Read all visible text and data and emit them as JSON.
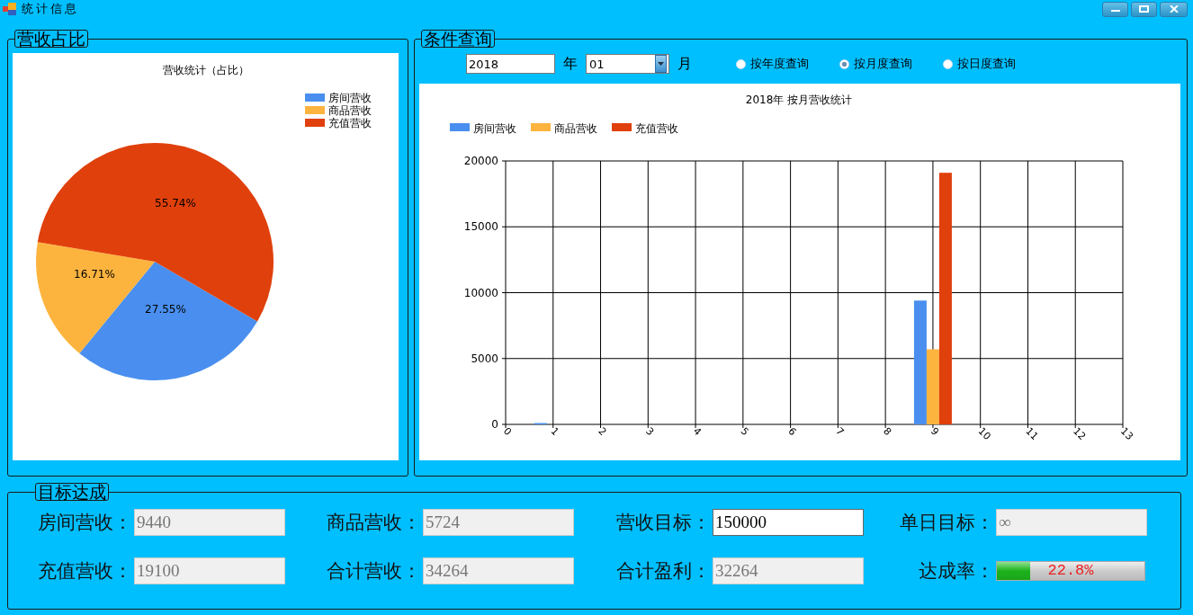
{
  "window": {
    "title": "统计信息"
  },
  "share_panel": {
    "title": "营收占比",
    "chart_data": {
      "type": "pie",
      "title": "营收统计（占比）",
      "categories": [
        "房间营收",
        "商品营收",
        "充值营收"
      ],
      "values": [
        27.55,
        16.71,
        55.74
      ],
      "colors": [
        "#4a8fef",
        "#fdb43f",
        "#e0400c"
      ],
      "value_labels": [
        "27.55%",
        "16.71%",
        "55.74%"
      ],
      "legend": "right"
    }
  },
  "query_panel": {
    "title": "条件查询",
    "year": "2018",
    "year_unit": "年",
    "month": "01",
    "month_unit": "月",
    "modes": [
      {
        "label": "按年度查询",
        "selected": false
      },
      {
        "label": "按月度查询",
        "selected": true
      },
      {
        "label": "按日度查询",
        "selected": false
      }
    ],
    "chart_data": {
      "type": "bar",
      "title": "2018年 按月营收统计",
      "x": [
        1,
        9
      ],
      "series": [
        {
          "name": "房间营收",
          "color": "#4a8fef",
          "values": [
            100,
            9400
          ]
        },
        {
          "name": "商品营收",
          "color": "#fdb43f",
          "values": [
            0,
            5700
          ]
        },
        {
          "name": "充值营收",
          "color": "#e0400c",
          "values": [
            0,
            19100
          ]
        }
      ],
      "legend": "top",
      "grid": true,
      "xlim": [
        0,
        13
      ],
      "ylim": [
        0,
        20000
      ],
      "xticks": [
        0,
        1,
        2,
        3,
        4,
        5,
        6,
        7,
        8,
        9,
        10,
        11,
        12,
        13
      ],
      "yticks": [
        0,
        5000,
        10000,
        15000,
        20000
      ]
    }
  },
  "goal_panel": {
    "title": "目标达成",
    "items": [
      {
        "kind": "field",
        "label": "房间营收：",
        "value": "9440",
        "disabled": true
      },
      {
        "kind": "field",
        "label": "商品营收：",
        "value": "5724",
        "disabled": true
      },
      {
        "kind": "field",
        "label": "营收目标：",
        "value": "150000",
        "disabled": false
      },
      {
        "kind": "field",
        "label": "单日目标：",
        "value": "∞",
        "disabled": true
      },
      {
        "kind": "field",
        "label": "充值营收：",
        "value": "19100",
        "disabled": true
      },
      {
        "kind": "field",
        "label": "合计营收：",
        "value": "34264",
        "disabled": true
      },
      {
        "kind": "field",
        "label": "合计盈利：",
        "value": "32264",
        "disabled": true
      },
      {
        "kind": "progress",
        "label": "达成率：",
        "level": 0.228,
        "text": "22.8%"
      }
    ]
  }
}
